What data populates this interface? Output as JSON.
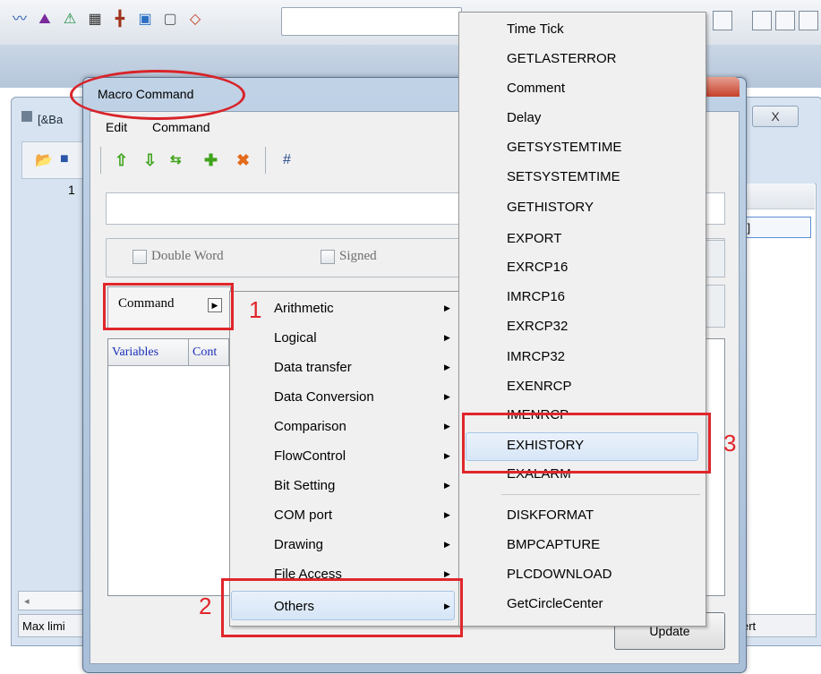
{
  "toolbar": {
    "icons": [
      "trend-chart-icon",
      "xy-chart-icon",
      "alarm-icon",
      "keypad-icon",
      "cross-icon",
      "window-icon",
      "xy-plot-icon",
      "valve-icon"
    ]
  },
  "background_window": {
    "title": "[&Ba",
    "close_label": "X",
    "row_number": "1",
    "grid_cell": "ro]",
    "status_left": "Max limi",
    "status_right": "ert"
  },
  "dialog": {
    "title": "Macro Command",
    "close_label": "X",
    "menu": {
      "edit": "Edit",
      "command": "Command"
    },
    "toolbar_hash": "#",
    "options": {
      "double_word": "Double Word",
      "signed": "Signed"
    },
    "command_button": "Command",
    "table_headers": [
      "Variables",
      "Cont"
    ],
    "update_button": "Update"
  },
  "submenu": {
    "items": [
      {
        "label": "Arithmetic"
      },
      {
        "label": "Logical"
      },
      {
        "label": "Data transfer"
      },
      {
        "label": "Data Conversion"
      },
      {
        "label": "Comparison"
      },
      {
        "label": "FlowControl"
      },
      {
        "label": "Bit Setting"
      },
      {
        "label": "COM port"
      },
      {
        "label": "Drawing"
      },
      {
        "label": "File Access"
      },
      {
        "label": "Others"
      }
    ],
    "selected": "Others"
  },
  "cascade_menu": {
    "items": [
      "Time Tick",
      "GETLASTERROR",
      "Comment",
      "Delay",
      "GETSYSTEMTIME",
      "SETSYSTEMTIME",
      "GETHISTORY",
      "EXPORT",
      "EXRCP16",
      "IMRCP16",
      "EXRCP32",
      "IMRCP32",
      "EXENRCP",
      "IMENRCP",
      "EXHISTORY",
      "EXALARM",
      "DISKFORMAT",
      "BMPCAPTURE",
      "PLCDOWNLOAD",
      "GetCircleCenter"
    ],
    "selected": "EXHISTORY"
  },
  "annotations": {
    "step1": "1",
    "step2": "2",
    "step3": "3"
  },
  "colors": {
    "annotation": "#e0262b",
    "highlight": "#d5e5f7",
    "dialog_frame": "#a9bfd8"
  }
}
